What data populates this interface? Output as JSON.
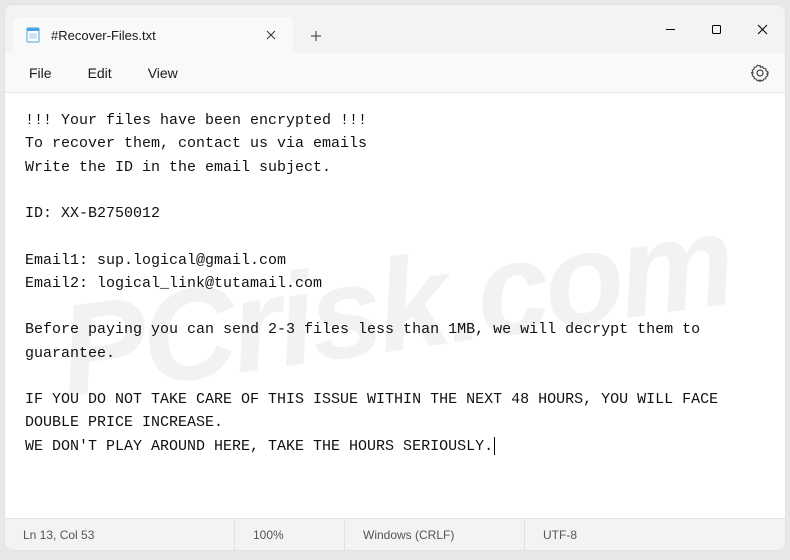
{
  "tab": {
    "title": "#Recover-Files.txt"
  },
  "menu": {
    "file": "File",
    "edit": "Edit",
    "view": "View"
  },
  "document": {
    "line1": "!!! Your files have been encrypted !!!",
    "line2": "To recover them, contact us via emails",
    "line3": "Write the ID in the email subject.",
    "blank1": "",
    "id_line": "ID: XX-B2750012",
    "blank2": "",
    "email1": "Email1: sup.logical@gmail.com",
    "email2": "Email2: logical_link@tutamail.com",
    "blank3": "",
    "guarantee": "Before paying you can send 2-3 files less than 1MB, we will decrypt them to guarantee.",
    "blank4": "",
    "warn1": "IF YOU DO NOT TAKE CARE OF THIS ISSUE WITHIN THE NEXT 48 HOURS, YOU WILL FACE DOUBLE PRICE INCREASE.",
    "warn2": "WE DON'T PLAY AROUND HERE, TAKE THE HOURS SERIOUSLY."
  },
  "status": {
    "position": "Ln 13, Col 53",
    "zoom": "100%",
    "line_ending": "Windows (CRLF)",
    "encoding": "UTF-8"
  },
  "watermark": "PCrisk.com"
}
